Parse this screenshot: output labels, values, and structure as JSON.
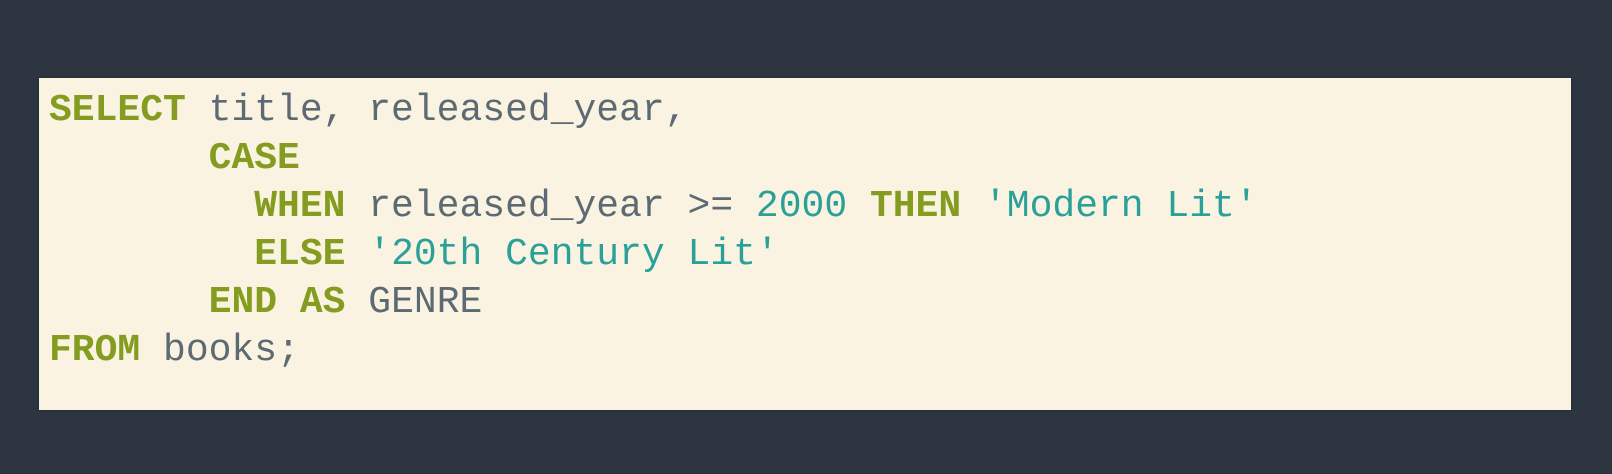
{
  "editor": {
    "colors": {
      "background": "#2d3540",
      "panel": "#fbf3e1",
      "keyword": "#849c1f",
      "identifier": "#5c6b73",
      "literal": "#2aa198",
      "selection": "#b4cfee"
    },
    "lines": [
      {
        "indent": "",
        "tokens": [
          {
            "type": "kw",
            "text": "SELECT"
          },
          {
            "type": "plain",
            "text": " title, released_year,"
          }
        ]
      },
      {
        "indent": "       ",
        "tokens": [
          {
            "type": "kw",
            "text": "CASE"
          }
        ]
      },
      {
        "indent": "         ",
        "tokens": [
          {
            "type": "kw",
            "text": "WHEN"
          },
          {
            "type": "plain",
            "text": " released_year >= "
          },
          {
            "type": "num",
            "text": "2000"
          },
          {
            "type": "plain",
            "text": " "
          },
          {
            "type": "kw",
            "text": "THEN"
          },
          {
            "type": "plain",
            "text": " "
          },
          {
            "type": "str",
            "text": "'Modern Lit'"
          }
        ]
      },
      {
        "indent": "         ",
        "tokens": [
          {
            "type": "kw",
            "text": "ELSE"
          },
          {
            "type": "plain",
            "text": " "
          },
          {
            "type": "str",
            "text": "'20th Century Lit'"
          }
        ]
      },
      {
        "indent": "       ",
        "tokens": [
          {
            "type": "kw",
            "text": "END"
          },
          {
            "type": "plain",
            "text": " "
          },
          {
            "type": "kw",
            "text": "AS"
          },
          {
            "type": "plain",
            "text": " GENRE"
          }
        ]
      },
      {
        "indent": "",
        "tokens": [
          {
            "type": "kw",
            "text": "FROM"
          },
          {
            "type": "plain",
            "text": " books;"
          }
        ]
      }
    ]
  }
}
